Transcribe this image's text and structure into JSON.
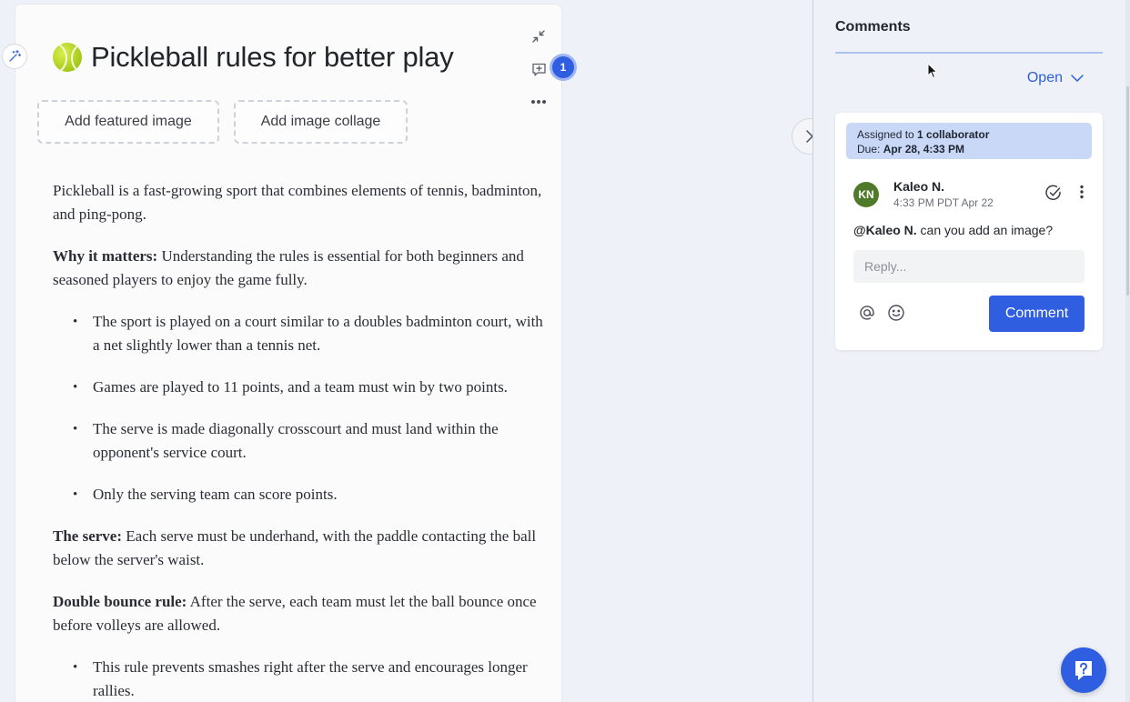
{
  "document": {
    "title": "Pickleball rules for better play",
    "buttons": {
      "featured_image": "Add featured image",
      "image_collage": "Add image collage"
    },
    "comment_count": "1",
    "intro": "Pickleball is a fast-growing sport that combines elements of tennis, badminton, and ping-pong.",
    "why": {
      "label": "Why it matters:",
      "text": " Understanding the rules is essential for both beginners and seasoned players to enjoy the game fully."
    },
    "rules_list": [
      "The sport is played on a court similar to a doubles badminton court, with a net slightly lower than a tennis net.",
      "Games are played to 11 points, and a team must win by two points.",
      "The serve is made diagonally crosscourt and must land within the opponent's service court.",
      "Only the serving team can score points."
    ],
    "serve": {
      "label": "The serve:",
      "text": " Each serve must be underhand, with the paddle contacting the ball below the server's waist."
    },
    "double_bounce": {
      "label": "Double bounce rule:",
      "text": " After the serve, each team must let the ball bounce once before volleys are allowed."
    },
    "double_bounce_list": [
      "This rule prevents smashes right after the serve and encourages longer rallies."
    ]
  },
  "comments_panel": {
    "title": "Comments",
    "filter_label": "Open",
    "comment": {
      "assigned_prefix": "Assigned to ",
      "assigned_count": "1 collaborator",
      "due_prefix": "Due: ",
      "due_date": "Apr 28, 4:33 PM",
      "avatar_initials": "KN",
      "author": "Kaleo N.",
      "time": "4:33 PM PDT Apr 22",
      "mention": "@Kaleo N.",
      "text": " can you add an image?",
      "reply_placeholder": "Reply...",
      "submit_label": "Comment"
    }
  },
  "colors": {
    "accent": "#2f5fe0",
    "avatar": "#4f7a2a",
    "assign_bg": "#c9d8f7"
  }
}
